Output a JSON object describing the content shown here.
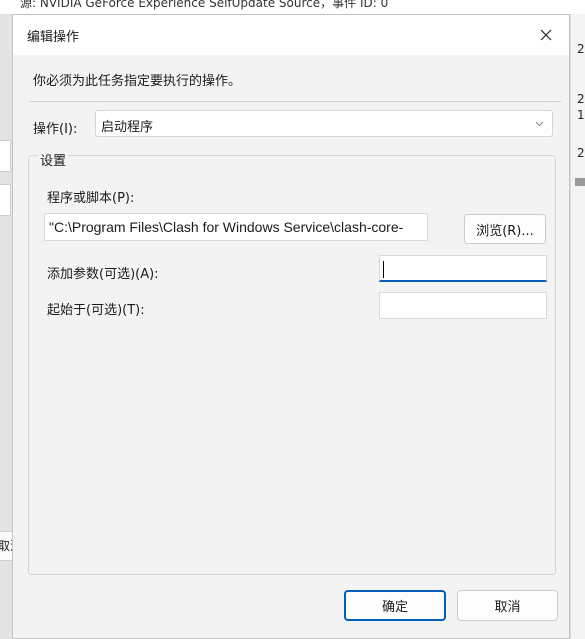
{
  "background": {
    "top_text": "源: NVIDIA GeForce Experience SelfUpdate Source，事件 ID: 0",
    "right_digits": [
      "2",
      "2",
      "1",
      "2"
    ],
    "left_button_fragment": "取消"
  },
  "dialog": {
    "title": "编辑操作",
    "instruction": "你必须为此任务指定要执行的操作。",
    "action": {
      "label": "操作(I):",
      "value": "启动程序"
    },
    "settings": {
      "label": "设置",
      "program": {
        "label": "程序或脚本(P):",
        "value": "\"C:\\Program Files\\Clash for Windows Service\\clash-core-"
      },
      "browse_label": "浏览(R)...",
      "args": {
        "label": "添加参数(可选)(A):",
        "value": ""
      },
      "start_in": {
        "label": "起始于(可选)(T):",
        "value": ""
      }
    },
    "ok_label": "确定",
    "cancel_label": "取消"
  },
  "colors": {
    "accent": "#005fb8",
    "dialog_bg": "#f3f3f3",
    "titlebar_bg": "#ffffff"
  },
  "icons": {
    "close": "close-icon",
    "dropdown": "chevron-down-icon"
  }
}
